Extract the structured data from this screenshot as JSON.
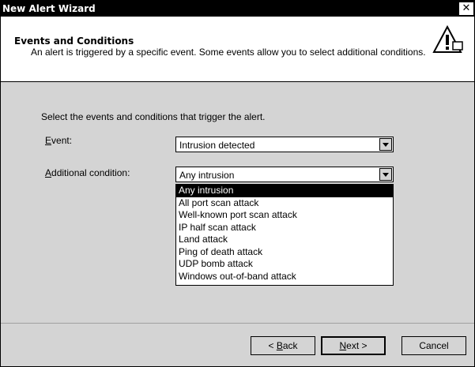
{
  "window": {
    "title": "New Alert Wizard",
    "close_glyph": "✕"
  },
  "header": {
    "title": "Events and Conditions",
    "description": "An alert is triggered by a specific event. Some events allow you to select additional conditions.",
    "icon": "warning-icon"
  },
  "form": {
    "intro": "Select the events and conditions that trigger the alert.",
    "event": {
      "label_prefix": "",
      "label_mnemonic": "E",
      "label_suffix": "vent:",
      "value": "Intrusion detected"
    },
    "condition": {
      "label_prefix": "",
      "label_mnemonic": "A",
      "label_suffix": "dditional condition:",
      "value": "Any intrusion",
      "options": [
        "Any intrusion",
        "All port scan attack",
        "Well-known port scan attack",
        "IP half scan attack",
        "Land attack",
        "Ping of death attack",
        "UDP bomb attack",
        "Windows out-of-band attack"
      ],
      "selected_index": 0
    }
  },
  "buttons": {
    "back": {
      "prefix": "< ",
      "mnemonic": "B",
      "suffix": "ack"
    },
    "next": {
      "prefix": "",
      "mnemonic": "N",
      "suffix": "ext >"
    },
    "cancel": "Cancel"
  }
}
